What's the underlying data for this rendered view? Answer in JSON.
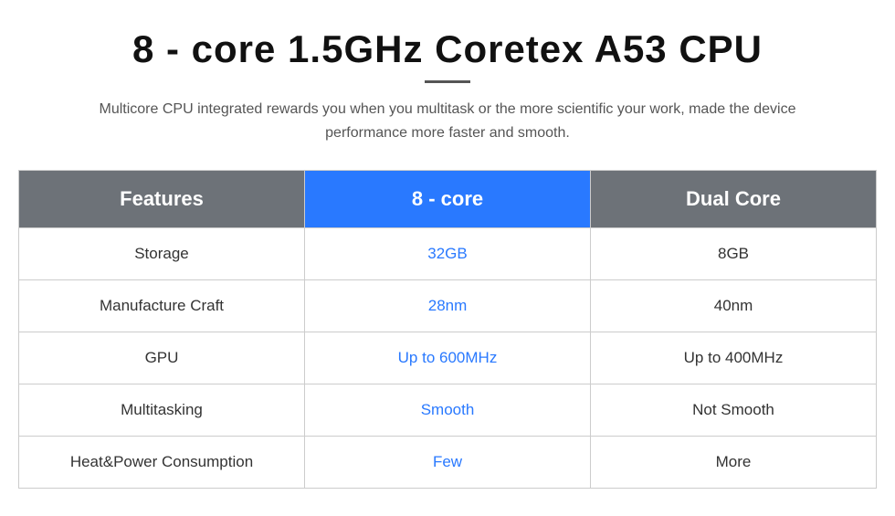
{
  "page": {
    "title": "8 - core 1.5GHz Coretex A53 CPU",
    "subtitle": "Multicore CPU integrated rewards you when you multitask or the more scientific your work, made the device performance more faster and smooth.",
    "table": {
      "headers": {
        "features": "Features",
        "col1": "8 - core",
        "col2": "Dual Core"
      },
      "rows": [
        {
          "feature": "Storage",
          "col1": "32GB",
          "col2": "8GB"
        },
        {
          "feature": "Manufacture Craft",
          "col1": "28nm",
          "col2": "40nm"
        },
        {
          "feature": "GPU",
          "col1": "Up to 600MHz",
          "col2": "Up to 400MHz"
        },
        {
          "feature": "Multitasking",
          "col1": "Smooth",
          "col2": "Not Smooth"
        },
        {
          "feature": "Heat&Power Consumption",
          "col1": "Few",
          "col2": "More"
        }
      ]
    }
  }
}
